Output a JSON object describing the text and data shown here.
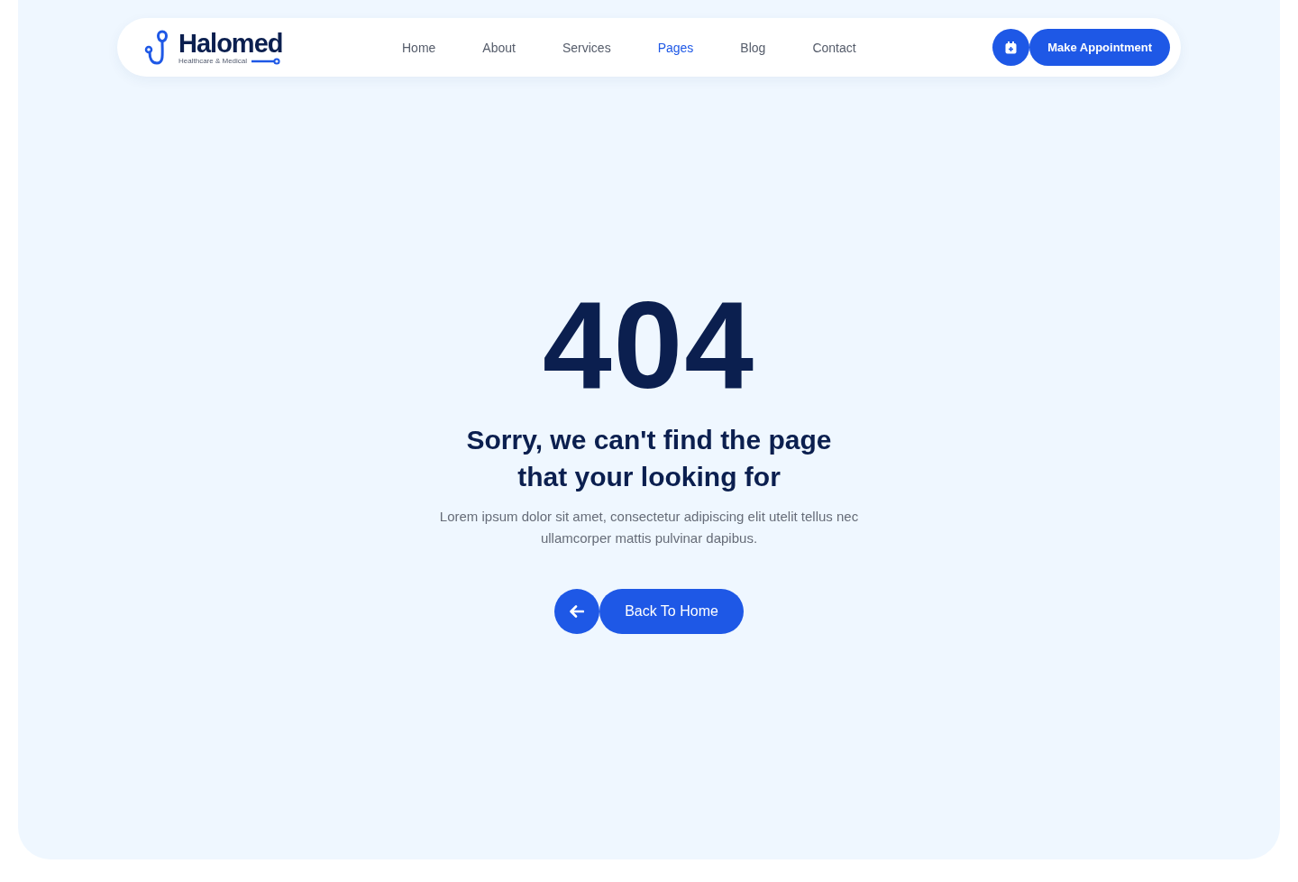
{
  "logo": {
    "name": "Halomed",
    "tagline": "Healthcare & Medical"
  },
  "nav": [
    {
      "label": "Home",
      "selected": false
    },
    {
      "label": "About",
      "selected": false
    },
    {
      "label": "Services",
      "selected": false
    },
    {
      "label": "Pages",
      "selected": true
    },
    {
      "label": "Blog",
      "selected": false
    },
    {
      "label": "Contact",
      "selected": false
    }
  ],
  "cta": {
    "label": "Make Appointment"
  },
  "error": {
    "code": "404",
    "heading": "Sorry, we can't find the page that your looking for",
    "text": "Lorem ipsum dolor sit amet, consectetur adipiscing elit utelit tellus nec ullamcorper mattis pulvinar dapibus.",
    "button": "Back To Home"
  }
}
